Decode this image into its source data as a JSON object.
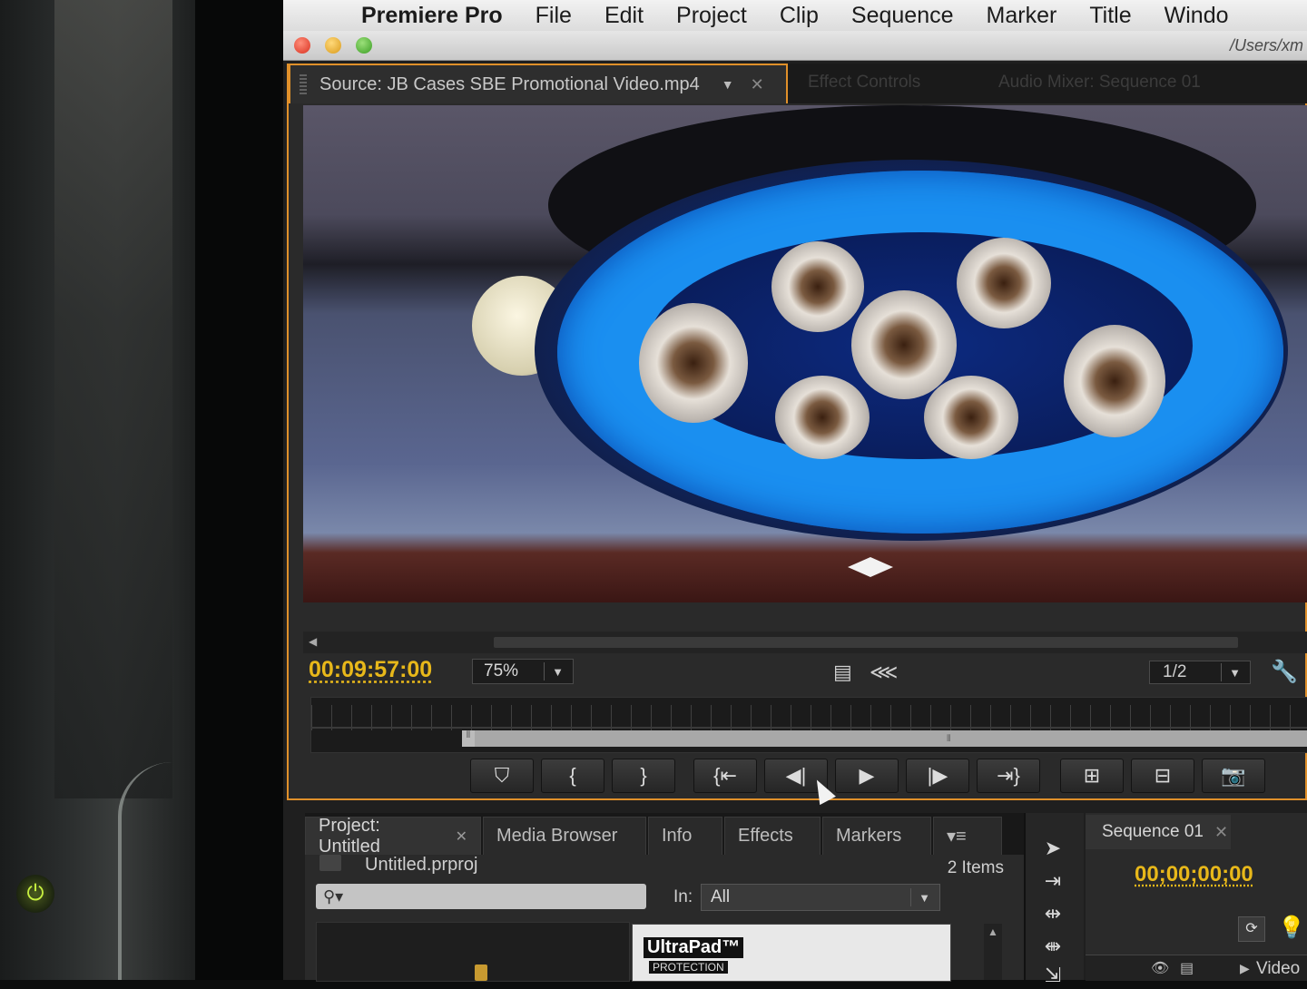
{
  "menubar": {
    "apple_icon": "apple-logo-icon",
    "items": [
      "Premiere Pro",
      "File",
      "Edit",
      "Project",
      "Clip",
      "Sequence",
      "Marker",
      "Title",
      "Windo"
    ]
  },
  "window": {
    "path": "/Users/xm"
  },
  "source_panel": {
    "tab_label": "Source: JB Cases SBE Promotional Video.mp4",
    "faded_tabs": [
      "Effect Controls",
      "Audio Mixer: Sequence 01"
    ],
    "timecode": "00:09:57:00",
    "zoom": "75%",
    "resolution": "1/2",
    "transport_icons": [
      "add-marker",
      "mark-in",
      "mark-out",
      "go-to-in",
      "step-back",
      "play",
      "step-forward",
      "go-to-out",
      "insert",
      "overwrite",
      "export-frame"
    ]
  },
  "project_panel": {
    "tabs": [
      "Project: Untitled",
      "Media Browser",
      "Info",
      "Effects",
      "Markers"
    ],
    "file": "Untitled.prproj",
    "items_count": "2 Items",
    "in_label": "In:",
    "in_value": "All",
    "thumb_brand": "UltraPad™",
    "thumb_sub": "PROTECTION"
  },
  "sequence_panel": {
    "tab_label": "Sequence 01",
    "timecode": "00;00;00;00",
    "track_label": "Video"
  },
  "colors": {
    "accent_orange": "#e0902a",
    "timecode_yellow": "#e8b81a"
  }
}
